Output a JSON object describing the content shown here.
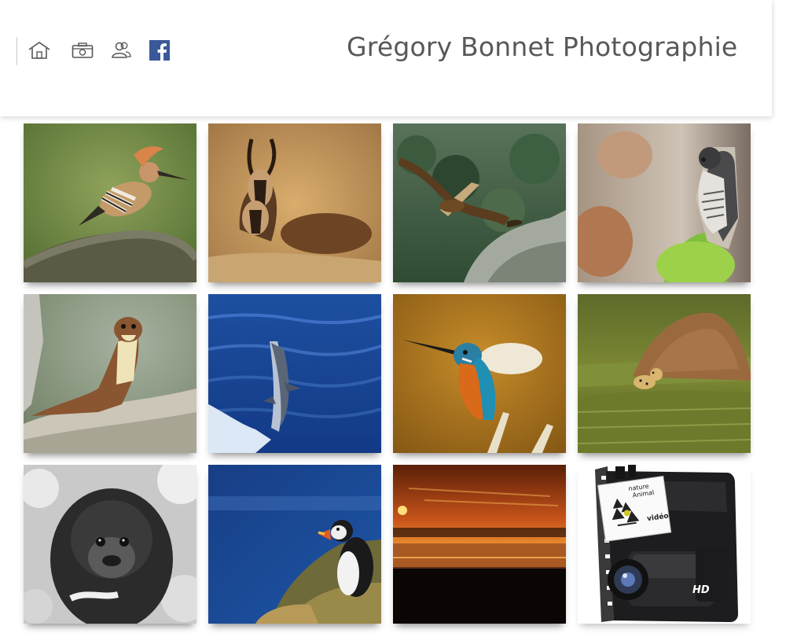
{
  "site": {
    "title": "Grégory Bonnet Photographie"
  },
  "nav": {
    "items": [
      {
        "icon": "home-icon"
      },
      {
        "icon": "camera-icon"
      },
      {
        "icon": "users-icon"
      },
      {
        "icon": "facebook-icon"
      }
    ]
  },
  "gallery": {
    "tiles": [
      {
        "subject": "hoopoe"
      },
      {
        "subject": "chamois"
      },
      {
        "subject": "eagle"
      },
      {
        "subject": "falcon"
      },
      {
        "subject": "stoat"
      },
      {
        "subject": "dolphin"
      },
      {
        "subject": "kingfisher"
      },
      {
        "subject": "cheetah"
      },
      {
        "subject": "gorilla"
      },
      {
        "subject": "puffin"
      },
      {
        "subject": "sunset"
      },
      {
        "subject": "video"
      }
    ],
    "video_tile": {
      "note_lines": [
        "nature",
        "Animal"
      ],
      "note_label": "vidéo",
      "badge": "HD"
    }
  },
  "colors": {
    "facebook": "#3b5998",
    "nav_icon": "#555555",
    "title": "#585858"
  }
}
